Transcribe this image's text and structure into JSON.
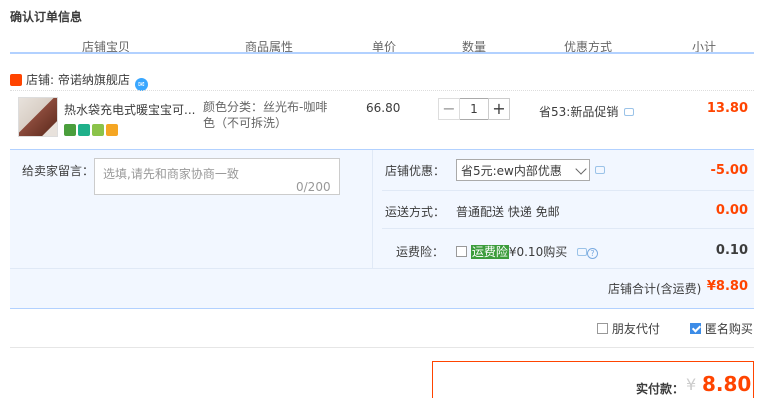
{
  "page": {
    "title": "确认订单信息"
  },
  "columns": [
    "店铺宝贝",
    "商品属性",
    "单价",
    "数量",
    "优惠方式",
    "小计"
  ],
  "shop": {
    "label": "店铺: 帝诺纳旗舰店"
  },
  "item": {
    "title": "热水袋充电式暖宝宝可...",
    "attr": "颜色分类：丝光布-咖啡色（不可拆洗）",
    "price": "66.80",
    "qty": "1",
    "qty_minus": "−",
    "qty_plus": "+",
    "promo": "省53:新品促销",
    "subtotal": "13.80"
  },
  "message": {
    "label": "给卖家留言：",
    "placeholder": "选填,请先和商家协商一致",
    "count": "0/200"
  },
  "coupon": {
    "label": "店铺优惠：",
    "selected": "省5元:ew内部优惠",
    "value": "-5.00"
  },
  "shipping": {
    "label": "运送方式：",
    "method": "普通配送 快递 免邮",
    "value": "0.00"
  },
  "insurance": {
    "label": "运费险：",
    "highlight": "运费险",
    "price_text": "¥0.10购买",
    "value": "0.10"
  },
  "shop_total": {
    "label": "店铺合计(含运费)",
    "value": "¥8.80"
  },
  "options": {
    "friend_pay": "朋友代付",
    "anonymous": "匿名购买"
  },
  "payment": {
    "label": "实付款：",
    "currency": "¥",
    "amount": "8.80"
  },
  "colors": {
    "accent": "#ff4400",
    "panel": "#f2f7ff",
    "border": "#b2d1ff"
  }
}
